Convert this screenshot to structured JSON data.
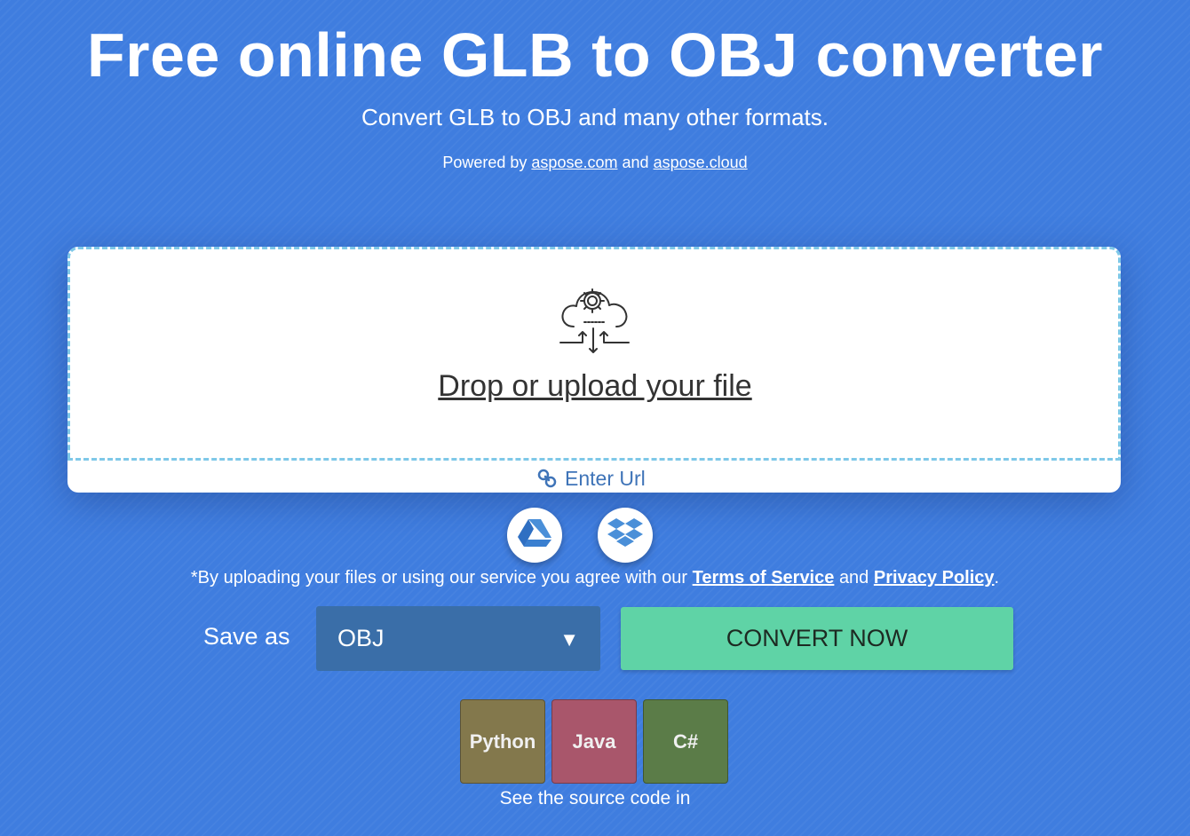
{
  "header": {
    "title": "Free online GLB to OBJ converter",
    "subtitle": "Convert GLB to OBJ and many other formats.",
    "powered_prefix": "Powered by",
    "powered_link1": "aspose.com",
    "powered_and": "and",
    "powered_link2": "aspose.cloud"
  },
  "upload": {
    "icon": "cloud-gear-upload-icon",
    "drop_label": "Drop or upload your file",
    "enter_url_label": "Enter Url",
    "enter_url_icon": "link-icon"
  },
  "cloud_sources": [
    {
      "icon": "google-drive-icon"
    },
    {
      "icon": "dropbox-icon"
    }
  ],
  "terms": {
    "prefix": "*By uploading your files or using our service you agree with our",
    "terms_link": "Terms of Service",
    "and": "and",
    "privacy_link": "Privacy Policy",
    "suffix": "."
  },
  "conversion": {
    "save_as_label": "Save as",
    "selected_format": "OBJ",
    "dropdown_arrow": "▼",
    "convert_label": "CONVERT NOW"
  },
  "source_code": {
    "languages": [
      "Python",
      "Java",
      "C#"
    ],
    "note": "See the source code in"
  },
  "colors": {
    "background": "#3f7ddf",
    "convert_button": "#5fd3a6",
    "select_background": "#3a6ea8",
    "python": "#83784c",
    "java": "#a9566b",
    "csharp": "#5b7c48"
  }
}
